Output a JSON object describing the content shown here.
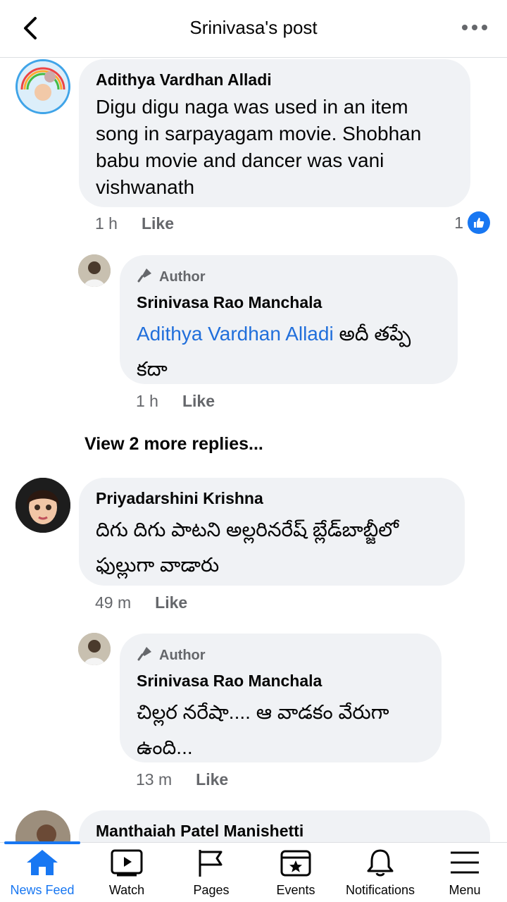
{
  "header": {
    "title": "Srinivasa's post"
  },
  "comments": [
    {
      "name": "Adithya Vardhan Alladi",
      "text": "Digu digu naga was used in an item song in sarpayagam movie. Shobhan babu movie and dancer was vani vishwanath",
      "time": "1 h",
      "like": "Like",
      "reaction_count": "1"
    },
    {
      "author_badge": "Author",
      "name": "Srinivasa Rao Manchala",
      "mention": "Adithya Vardhan Alladi",
      "text": " అదీ తప్పే కదా",
      "time": "1 h",
      "like": "Like"
    },
    {
      "name": "Priyadarshini Krishna",
      "text": "దిగు దిగు పాటని అల్లరినరేష్ బ్లేడ్‌బాబ్జీలో ఫుల్లుగా వాడారు",
      "time": "49 m",
      "like": "Like"
    },
    {
      "author_badge": "Author",
      "name": "Srinivasa Rao Manchala",
      "text": "చిల్లర నరేషా.... ఆ వాడకం వేరుగా ఉంది...",
      "time": "13 m",
      "like": "Like"
    },
    {
      "name": "Manthaiah Patel Manishetti"
    }
  ],
  "view_more": "View 2 more replies...",
  "tabs": [
    {
      "label": "News Feed",
      "icon": "home-icon",
      "active": true
    },
    {
      "label": "Watch",
      "icon": "watch-icon"
    },
    {
      "label": "Pages",
      "icon": "flag-icon"
    },
    {
      "label": "Events",
      "icon": "calendar-icon"
    },
    {
      "label": "Notifications",
      "icon": "bell-icon"
    },
    {
      "label": "Menu",
      "icon": "menu-icon"
    }
  ],
  "colors": {
    "accent": "#1877f2",
    "bubble": "#f0f2f5",
    "mention": "#216fdb",
    "meta": "#65676b"
  }
}
